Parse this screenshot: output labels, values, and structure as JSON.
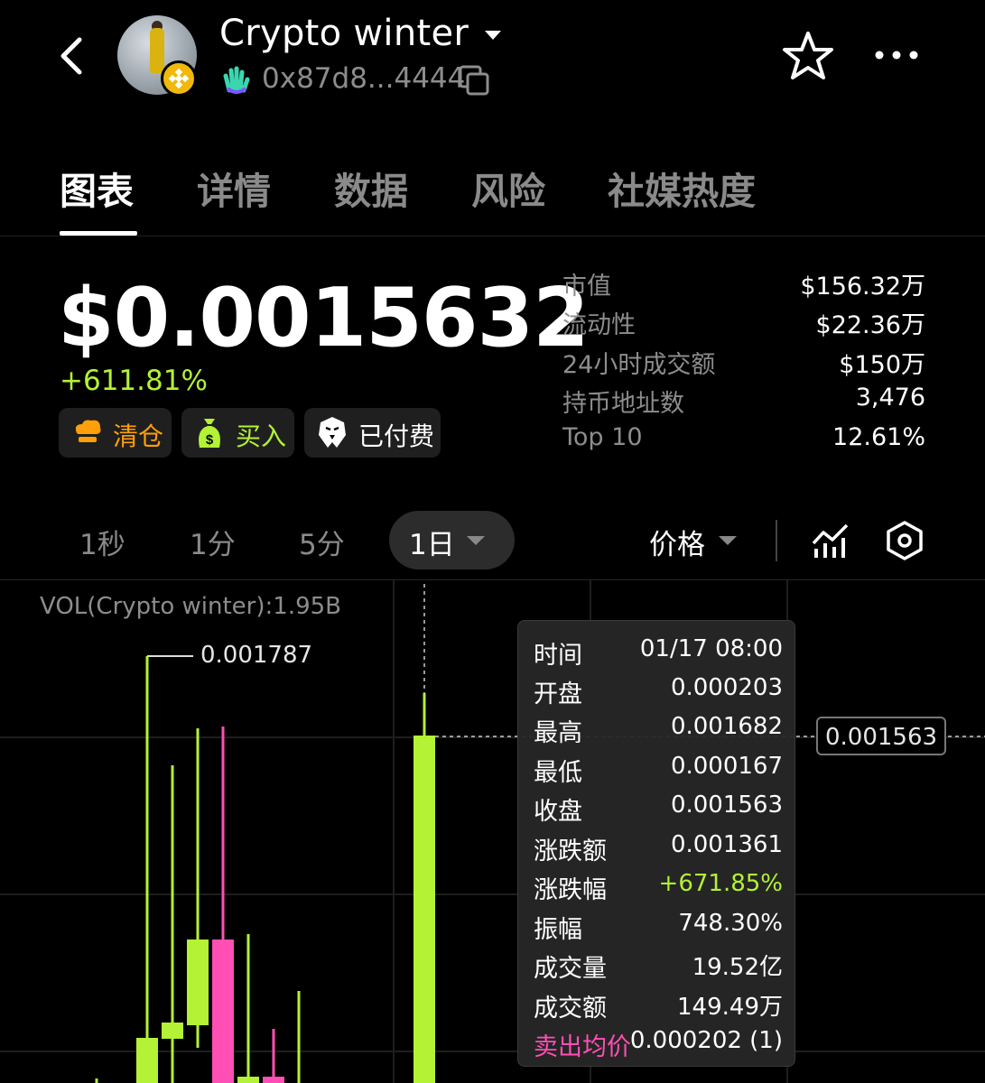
{
  "header": {
    "title": "Crypto winter",
    "address": "0x87d8...4444"
  },
  "tabs": [
    {
      "label": "图表"
    },
    {
      "label": "详情"
    },
    {
      "label": "数据"
    },
    {
      "label": "风险"
    },
    {
      "label": "社媒热度"
    }
  ],
  "price": {
    "value": "$0.0015632",
    "change": "+611.81%"
  },
  "actions": [
    {
      "label": "清仓",
      "color": "#ff9f0a"
    },
    {
      "label": "买入",
      "color": "#b3f234"
    },
    {
      "label": "已付费",
      "color": "#ffffff"
    }
  ],
  "stats": [
    {
      "label": "市值",
      "value": "$156.32万"
    },
    {
      "label": "流动性",
      "value": "$22.36万"
    },
    {
      "label": "24小时成交额",
      "value": "$150万"
    },
    {
      "label": "持币地址数",
      "value": "3,476"
    },
    {
      "label": "Top 10",
      "value": "12.61%"
    }
  ],
  "timeframes": [
    {
      "label": "1秒"
    },
    {
      "label": "1分"
    },
    {
      "label": "5分"
    }
  ],
  "selected_timeframe": "1日",
  "price_selector": "价格",
  "chart": {
    "volume_label": "VOL(Crypto winter):1.95B",
    "max_label": "0.001787",
    "current_price_tag": "0.001563"
  },
  "tooltip": [
    {
      "key": "时间",
      "value": "01/17 08:00"
    },
    {
      "key": "开盘",
      "value": "0.000203"
    },
    {
      "key": "最高",
      "value": "0.001682"
    },
    {
      "key": "最低",
      "value": "0.000167"
    },
    {
      "key": "收盘",
      "value": "0.001563"
    },
    {
      "key": "涨跌额",
      "value": "0.001361"
    },
    {
      "key": "涨跌幅",
      "value": "+671.85%"
    },
    {
      "key": "振幅",
      "value": "748.30%"
    },
    {
      "key": "成交量",
      "value": "19.52亿"
    },
    {
      "key": "成交额",
      "value": "149.49万"
    },
    {
      "key": "卖出均价",
      "value": "0.000202 (1)"
    }
  ],
  "colors": {
    "up": "#b3f234",
    "down": "#ff4fb5",
    "accent_gold": "#f0b90b"
  }
}
